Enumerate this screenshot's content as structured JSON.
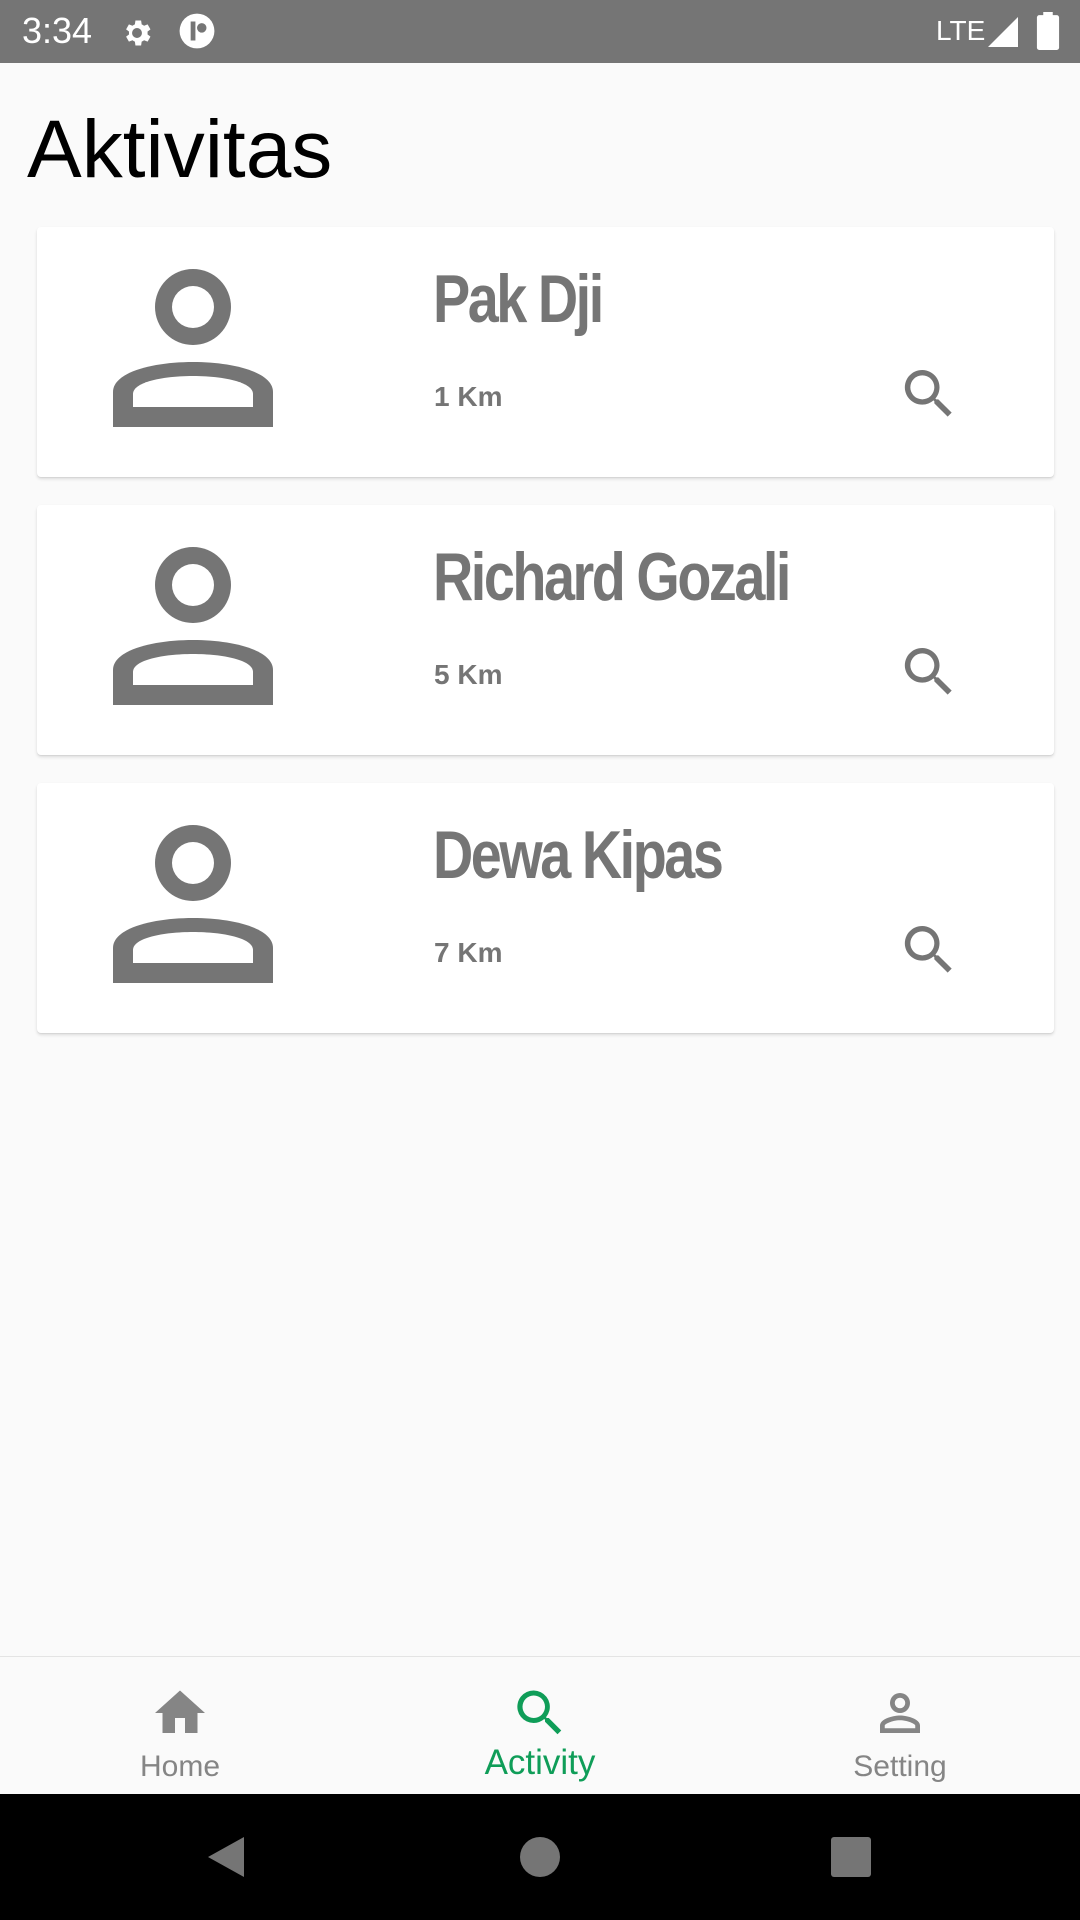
{
  "status_bar": {
    "time": "3:34",
    "network": "LTE",
    "icons": [
      "settings-gear-icon",
      "app-notification-icon",
      "signal-icon",
      "battery-icon"
    ]
  },
  "page": {
    "title": "Aktivitas"
  },
  "activities": [
    {
      "name": "Pak Dji",
      "distance": "1 Km",
      "avatar_icon": "person-icon",
      "action_icon": "search-icon"
    },
    {
      "name": "Richard Gozali",
      "distance": "5 Km",
      "avatar_icon": "person-icon",
      "action_icon": "search-icon"
    },
    {
      "name": "Dewa Kipas",
      "distance": "7 Km",
      "avatar_icon": "person-icon",
      "action_icon": "search-icon"
    }
  ],
  "bottom_nav": {
    "items": [
      {
        "label": "Home",
        "icon": "home-icon",
        "active": false
      },
      {
        "label": "Activity",
        "icon": "search-icon",
        "active": true
      },
      {
        "label": "Setting",
        "icon": "person-icon",
        "active": false
      }
    ],
    "active_color": "#0f9d58",
    "inactive_color": "#858585"
  },
  "system_nav": {
    "buttons": [
      "back-icon",
      "home-circle-icon",
      "recents-icon"
    ]
  },
  "colors": {
    "status_bar": "#757575",
    "background": "#fafafa",
    "card": "#ffffff",
    "text_secondary": "#757575",
    "accent": "#0f9d58"
  }
}
